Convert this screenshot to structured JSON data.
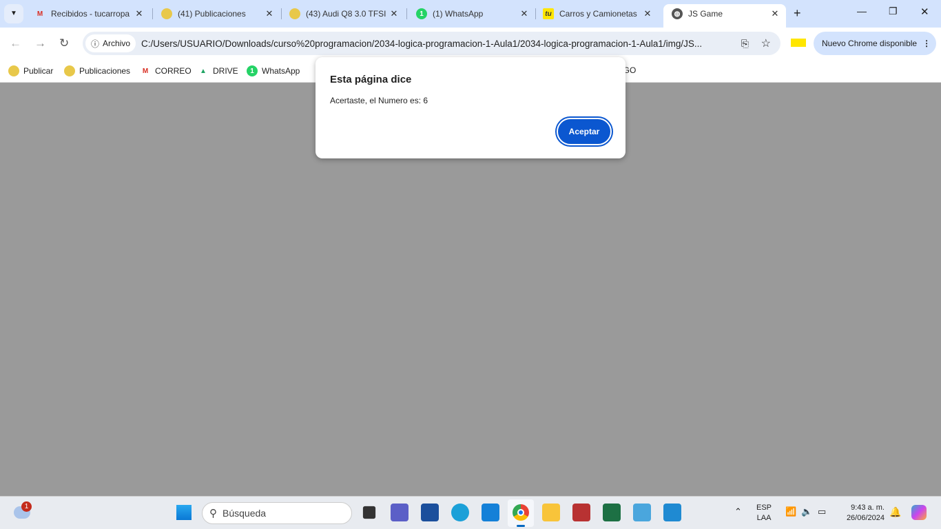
{
  "tabs": [
    {
      "title": "Recibidos - tucarropa",
      "icon": "gmail-icon"
    },
    {
      "title": "(41) Publicaciones",
      "icon": "tucarro-icon"
    },
    {
      "title": "(43) Audi Q8 3.0 TFSI",
      "icon": "tucarro-icon"
    },
    {
      "title": "(1) WhatsApp",
      "icon": "whatsapp-icon"
    },
    {
      "title": "Carros y Camionetas",
      "icon": "tu-icon"
    },
    {
      "title": "JS Game",
      "icon": "globe-icon",
      "active": true
    }
  ],
  "toolbar": {
    "chip": "Archivo",
    "url": "C:/Users/USUARIO/Downloads/curso%20programacion/2034-logica-programacion-1-Aula1/2034-logica-programacion-1-Aula1/img/JS...",
    "update": "Nuevo Chrome disponible"
  },
  "bookmarks": [
    "Publicar",
    "Publicaciones",
    "CORREO",
    "DRIVE",
    "WhatsApp",
    "IIGO"
  ],
  "dialog": {
    "title": "Esta página dice",
    "message": "Acertaste, el Numero es: 6",
    "ok": "Aceptar"
  },
  "taskbar": {
    "search_placeholder": "Búsqueda",
    "weather_badge": "1",
    "lang1": "ESP",
    "lang2": "LAA",
    "time": "9:43 a. m.",
    "date": "26/06/2024"
  },
  "colors": {
    "accent": "#0b57d0",
    "tabbar": "#d3e3fd",
    "page": "#9a9a9a"
  }
}
